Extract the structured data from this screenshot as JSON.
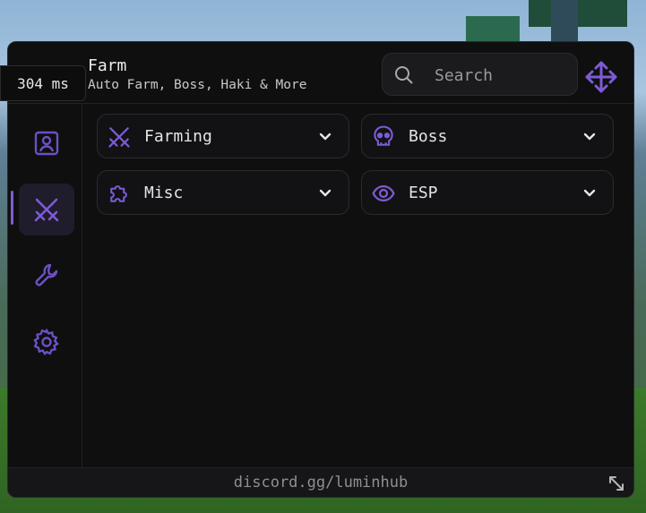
{
  "header": {
    "title": "Farm",
    "subtitle": "Auto Farm, Boss, Haki & More"
  },
  "ping": {
    "label": "304 ms"
  },
  "search": {
    "placeholder": "Search"
  },
  "sidebar": {
    "items": [
      {
        "icon": "user-icon",
        "active": false
      },
      {
        "icon": "swords-icon",
        "active": true
      },
      {
        "icon": "wrench-icon",
        "active": false
      },
      {
        "icon": "gear-icon",
        "active": false
      }
    ]
  },
  "sections": [
    {
      "label": "Farming",
      "icon": "swords-icon"
    },
    {
      "label": "Boss",
      "icon": "skull-icon"
    },
    {
      "label": "Misc",
      "icon": "puzzle-icon"
    },
    {
      "label": "ESP",
      "icon": "eye-icon"
    }
  ],
  "footer": {
    "text": "discord.gg/luminhub"
  },
  "colors": {
    "accent": "#7d5bd6",
    "window_bg": "#0f0f10",
    "card_bg": "#121214"
  }
}
